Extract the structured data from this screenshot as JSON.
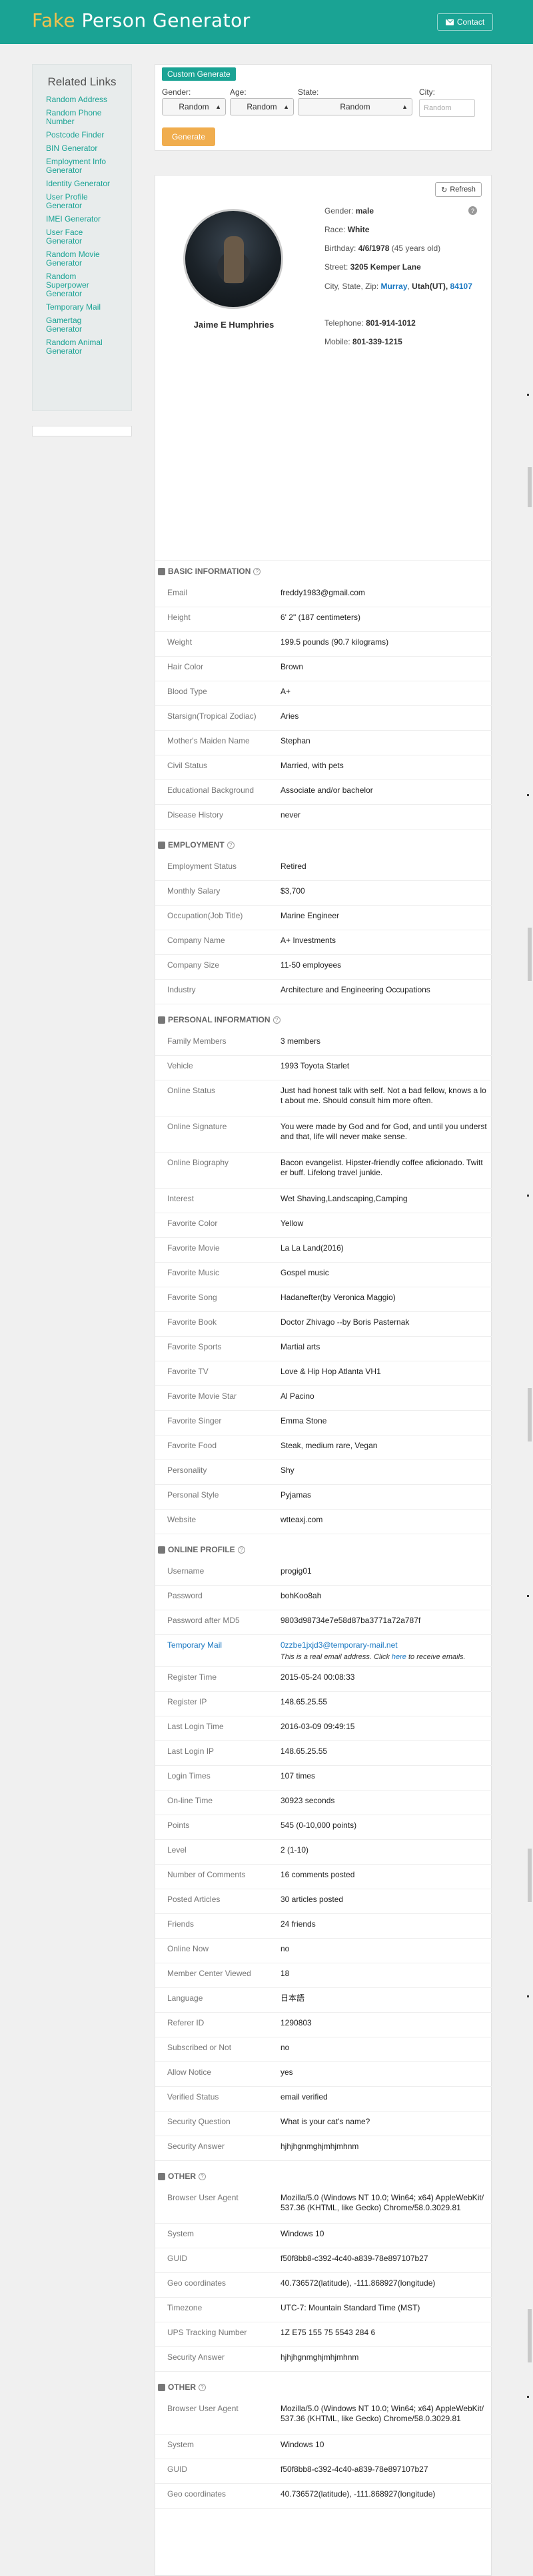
{
  "header": {
    "logo_fake": "Fake",
    "logo_rest": " Person Generator",
    "contact_label": "Contact"
  },
  "sidebar": {
    "title": "Related Links",
    "items": [
      "Random Address",
      "Random Phone Number",
      "Postcode Finder",
      "BIN Generator",
      "Employment Info Generator",
      "Identity Generator",
      "User Profile Generator",
      "IMEI Generator",
      "User Face Generator",
      "Random Movie Generator",
      "Random Superpower Generator",
      "Temporary Mail",
      "Gamertag Generator",
      "Random Animal Generator"
    ]
  },
  "generator": {
    "tag": "Custom Generate",
    "gender_label": "Gender:",
    "gender_value": "Random",
    "age_label": "Age:",
    "age_value": "Random",
    "state_label": "State:",
    "state_value": "Random",
    "city_label": "City:",
    "city_placeholder": "Random",
    "generate_label": "Generate"
  },
  "profile": {
    "refresh_label": "Refresh",
    "name": "Jaime E Humphries",
    "gender_label": "Gender:",
    "gender": "male",
    "race_label": "Race:",
    "race": "White",
    "birthday_label": "Birthday:",
    "birthday": "4/6/1978",
    "birthday_note": "(45 years old)",
    "street_label": "Street:",
    "street": "3205 Kemper Lane",
    "city_label": "City, State, Zip:",
    "city": "Murray",
    "state": "Utah(UT),",
    "zip": "84107",
    "telephone_label": "Telephone:",
    "telephone": "801-914-1012",
    "mobile_label": "Mobile:",
    "mobile": "801-339-1215"
  },
  "sections": [
    {
      "title": "Basic Information",
      "rows": [
        [
          "Email",
          "freddy1983@gmail.com"
        ],
        [
          "Height",
          "6' 2\" (187 centimeters)"
        ],
        [
          "Weight",
          "199.5 pounds (90.7 kilograms)"
        ],
        [
          "Hair Color",
          "Brown"
        ],
        [
          "Blood Type",
          "A+"
        ],
        [
          "Starsign(Tropical Zodiac)",
          "Aries"
        ],
        [
          "Mother's Maiden Name",
          "Stephan"
        ],
        [
          "Civil Status",
          "Married, with pets"
        ],
        [
          "Educational Background",
          "Associate and/or bachelor"
        ],
        [
          "Disease History",
          "never"
        ]
      ]
    },
    {
      "title": "Employment",
      "rows": [
        [
          "Employment Status",
          "Retired"
        ],
        [
          "Monthly Salary",
          "$3,700"
        ],
        [
          "Occupation(Job Title)",
          "Marine Engineer"
        ],
        [
          "Company Name",
          "A+ Investments"
        ],
        [
          "Company Size",
          "11-50 employees"
        ],
        [
          "Industry",
          "Architecture and Engineering Occupations"
        ]
      ]
    },
    {
      "title": "Personal Information",
      "rows": [
        [
          "Family Members",
          "3 members"
        ],
        [
          "Vehicle",
          "1993 Toyota Starlet"
        ],
        [
          "Online Status",
          "Just had honest talk with self. Not a bad fellow, knows a lot about me. Should consult him more often."
        ],
        [
          "Online Signature",
          "You were made by God and for God, and until you understand that, life will never make sense."
        ],
        [
          "Online Biography",
          "Bacon evangelist. Hipster-friendly coffee aficionado. Twitter buff. Lifelong travel junkie."
        ],
        [
          "Interest",
          "Wet Shaving,Landscaping,Camping"
        ],
        [
          "Favorite Color",
          "Yellow"
        ],
        [
          "Favorite Movie",
          "La La Land(2016)"
        ],
        [
          "Favorite Music",
          "Gospel music"
        ],
        [
          "Favorite Song",
          "Hadanefter(by Veronica Maggio)"
        ],
        [
          "Favorite Book",
          "Doctor Zhivago --by Boris Pasternak"
        ],
        [
          "Favorite Sports",
          "Martial arts"
        ],
        [
          "Favorite TV",
          "Love & Hip Hop Atlanta VH1"
        ],
        [
          "Favorite Movie Star",
          "Al Pacino"
        ],
        [
          "Favorite Singer",
          "Emma Stone"
        ],
        [
          "Favorite Food",
          "Steak, medium rare, Vegan"
        ],
        [
          "Personality",
          "Shy"
        ],
        [
          "Personal Style",
          "Pyjamas"
        ],
        [
          "Website",
          "wtteaxj.com"
        ]
      ]
    },
    {
      "title": "Online Profile",
      "rows": [
        [
          "Username",
          "progig01"
        ],
        [
          "Password",
          "bohKoo8ah"
        ],
        [
          "Password after MD5",
          "9803d98734e7e58d87ba3771a72a787f"
        ],
        [
          "Temporary Mail",
          "0zzbe1jxjd3@temporary-mail.net"
        ],
        [
          "Register Time",
          "2015-05-24 00:08:33"
        ],
        [
          "Register IP",
          "148.65.25.55"
        ],
        [
          "Last Login Time",
          "2016-03-09 09:49:15"
        ],
        [
          "Last Login IP",
          "148.65.25.55"
        ],
        [
          "Login Times",
          "107 times"
        ],
        [
          "On-line Time",
          "30923 seconds"
        ],
        [
          "Points",
          "545 (0-10,000 points)"
        ],
        [
          "Level",
          "2 (1-10)"
        ],
        [
          "Number of Comments",
          "16 comments posted"
        ],
        [
          "Posted Articles",
          "30 articles posted"
        ],
        [
          "Friends",
          "24 friends"
        ],
        [
          "Online Now",
          "no"
        ],
        [
          "Member Center Viewed",
          "18"
        ],
        [
          "Language",
          "日本語"
        ],
        [
          "Referer ID",
          "1290803"
        ],
        [
          "Subscribed or Not",
          "no"
        ],
        [
          "Allow Notice",
          "yes"
        ],
        [
          "Verified Status",
          "email verified"
        ],
        [
          "Security Question",
          "What is your cat's name?"
        ],
        [
          "Security Answer",
          "hjhjhgnmghjmhjmhnm"
        ]
      ]
    },
    {
      "title": "Other",
      "rows": [
        [
          "Browser User Agent",
          "Mozilla/5.0 (Windows NT 10.0; Win64; x64) AppleWebKit/537.36 (KHTML, like Gecko) Chrome/58.0.3029.81"
        ],
        [
          "System",
          "Windows 10"
        ],
        [
          "GUID",
          "f50f8bb8-c392-4c40-a839-78e897107b27"
        ],
        [
          "Geo coordinates",
          "40.736572(latitude), -111.868927(longitude)"
        ],
        [
          "Timezone",
          "UTC-7: Mountain Standard Time (MST)"
        ],
        [
          "UPS Tracking Number",
          "1Z E75 155 75 5543 284 6"
        ],
        [
          "Security Answer",
          "hjhjhgnmghjmhjmhnm"
        ]
      ]
    },
    {
      "title": "Other",
      "rows": [
        [
          "Browser User Agent",
          "Mozilla/5.0 (Windows NT 10.0; Win64; x64) AppleWebKit/537.36 (KHTML, like Gecko) Chrome/58.0.3029.81"
        ],
        [
          "System",
          "Windows 10"
        ],
        [
          "GUID",
          "f50f8bb8-c392-4c40-a839-78e897107b27"
        ],
        [
          "Geo coordinates",
          "40.736572(latitude), -111.868927(longitude)"
        ]
      ]
    }
  ],
  "temp_mail_note": {
    "before": "This is a real email address. Click ",
    "link": "here",
    "after": " to receive emails."
  }
}
